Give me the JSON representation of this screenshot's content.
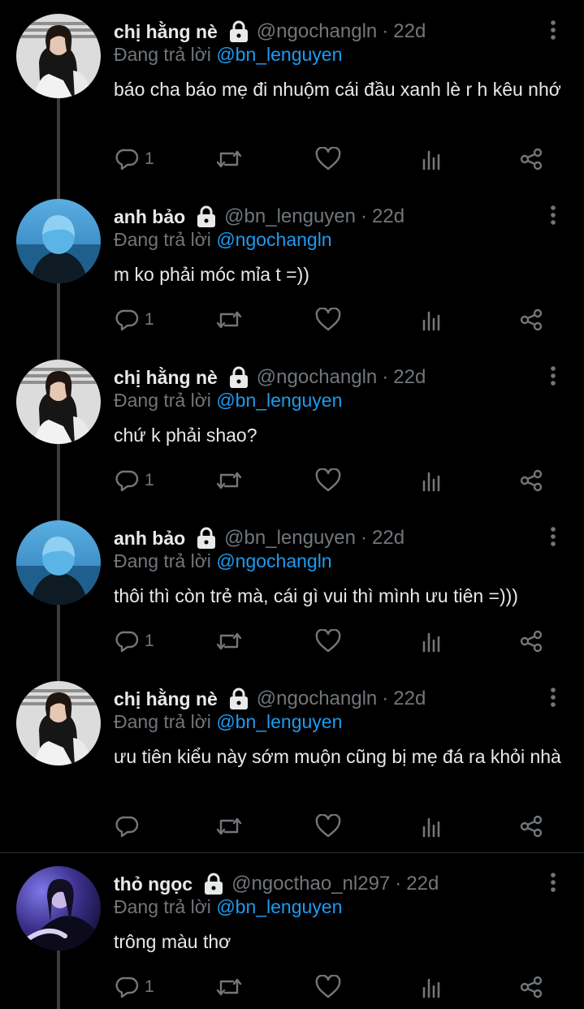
{
  "replies": [
    {
      "display_name": "chị hằng nè",
      "handle": "@ngochangln",
      "time": "22d",
      "replying_to_label": "Đang trả lời",
      "replying_to": "@bn_lenguyen",
      "text": "báo cha báo mẹ đi nhuộm cái đầu xanh lè r h kêu nhớ",
      "reply_count": "1",
      "avatar": "girl-portrait"
    },
    {
      "display_name": "anh bảo",
      "handle": "@bn_lenguyen",
      "time": "22d",
      "replying_to_label": "Đang trả lời",
      "replying_to": "@ngochangln",
      "text": "m ko phải móc mỉa t =))",
      "reply_count": "1",
      "avatar": "blue-hair-back"
    },
    {
      "display_name": "chị hằng nè",
      "handle": "@ngochangln",
      "time": "22d",
      "replying_to_label": "Đang trả lời",
      "replying_to": "@bn_lenguyen",
      "text": "chứ k phải shao?",
      "reply_count": "1",
      "avatar": "girl-portrait"
    },
    {
      "display_name": "anh bảo",
      "handle": "@bn_lenguyen",
      "time": "22d",
      "replying_to_label": "Đang trả lời",
      "replying_to": "@ngochangln",
      "text": "thôi thì còn trẻ mà, cái gì vui thì mình ưu tiên =)))",
      "reply_count": "1",
      "avatar": "blue-hair-back"
    },
    {
      "display_name": "chị hằng nè",
      "handle": "@ngochangln",
      "time": "22d",
      "replying_to_label": "Đang trả lời",
      "replying_to": "@bn_lenguyen",
      "text": "ưu tiên kiểu này sớm muộn cũng bị mẹ đá ra khỏi nhà",
      "reply_count": "",
      "avatar": "girl-portrait"
    },
    {
      "display_name": "thỏ ngọc",
      "handle": "@ngocthao_nl297",
      "time": "22d",
      "replying_to_label": "Đang trả lời",
      "replying_to": "@bn_lenguyen",
      "text": "trông màu thơ",
      "reply_count": "1",
      "avatar": "purple-night-portrait"
    }
  ],
  "icons": {
    "reply": "reply-icon",
    "retweet": "retweet-icon",
    "like": "heart-icon",
    "views": "views-icon",
    "share": "share-icon",
    "lock": "lock-icon",
    "more": "more-vertical-icon"
  },
  "colors": {
    "background": "#000000",
    "text": "#e7e9ea",
    "secondary": "#71767b",
    "link": "#1d9bf0",
    "thread_line": "#3a3d40"
  }
}
